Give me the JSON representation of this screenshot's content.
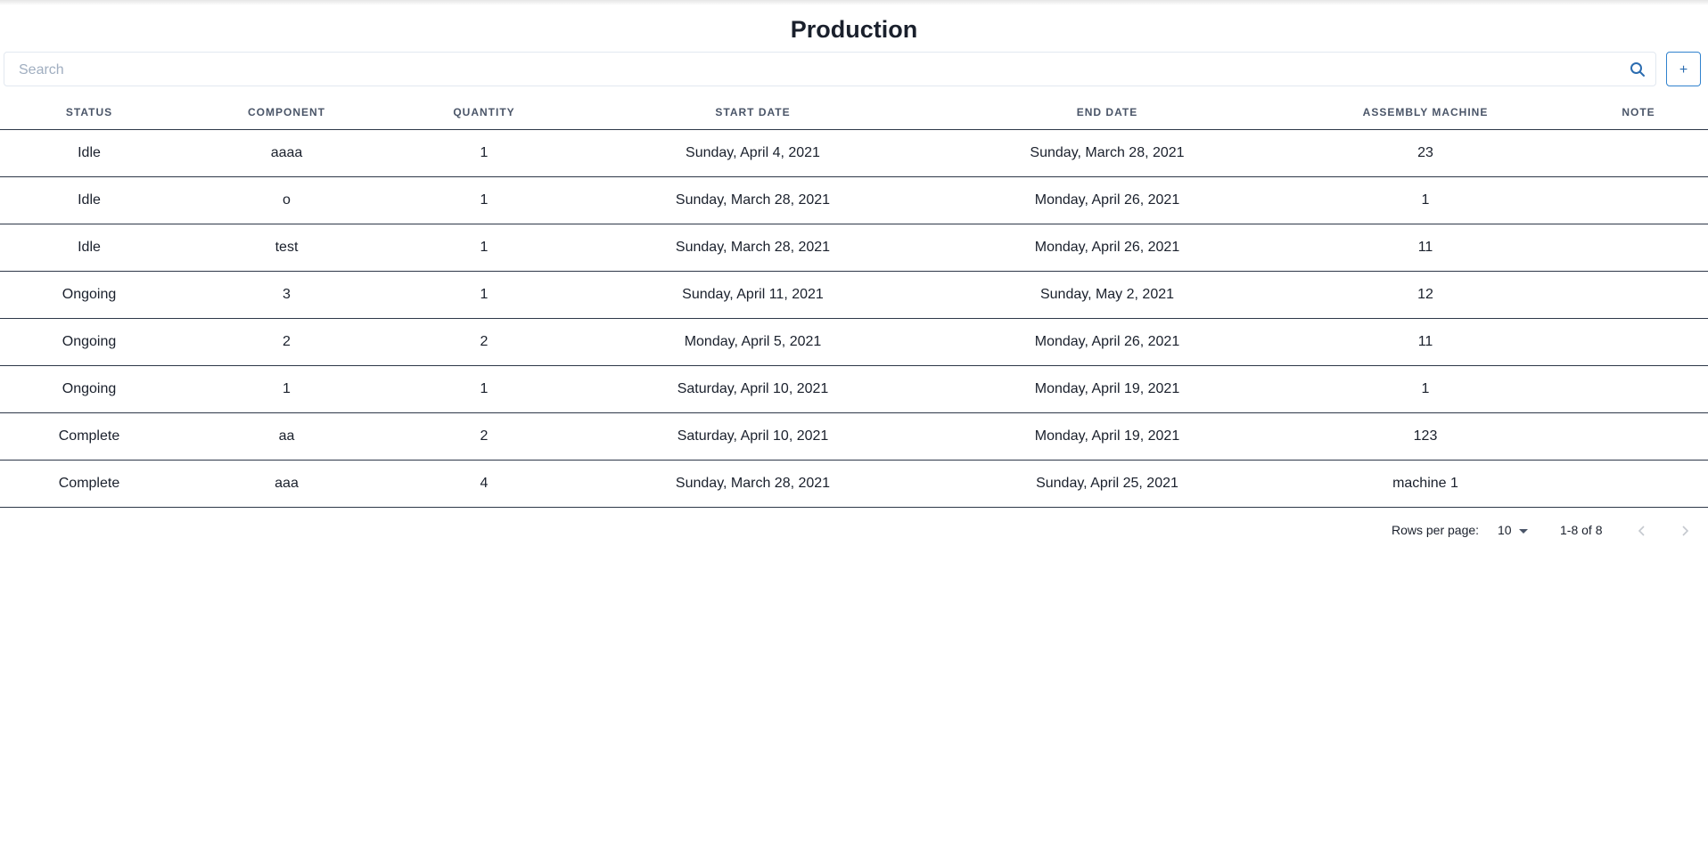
{
  "page": {
    "title": "Production"
  },
  "search": {
    "placeholder": "Search",
    "value": ""
  },
  "toolbar": {
    "add_label": "+"
  },
  "table": {
    "columns": [
      "Status",
      "Component",
      "Quantity",
      "Start Date",
      "End Date",
      "Assembly Machine",
      "Note"
    ],
    "rows": [
      [
        "Idle",
        "aaaa",
        "1",
        "Sunday, April 4, 2021",
        "Sunday, March 28, 2021",
        "23",
        ""
      ],
      [
        "Idle",
        "o",
        "1",
        "Sunday, March 28, 2021",
        "Monday, April 26, 2021",
        "1",
        ""
      ],
      [
        "Idle",
        "test",
        "1",
        "Sunday, March 28, 2021",
        "Monday, April 26, 2021",
        "11",
        ""
      ],
      [
        "Ongoing",
        "3",
        "1",
        "Sunday, April 11, 2021",
        "Sunday, May 2, 2021",
        "12",
        ""
      ],
      [
        "Ongoing",
        "2",
        "2",
        "Monday, April 5, 2021",
        "Monday, April 26, 2021",
        "11",
        ""
      ],
      [
        "Ongoing",
        "1",
        "1",
        "Saturday, April 10, 2021",
        "Monday, April 19, 2021",
        "1",
        ""
      ],
      [
        "Complete",
        "aa",
        "2",
        "Saturday, April 10, 2021",
        "Monday, April 19, 2021",
        "123",
        ""
      ],
      [
        "Complete",
        "aaa",
        "4",
        "Sunday, March 28, 2021",
        "Sunday, April 25, 2021",
        "machine 1",
        ""
      ]
    ]
  },
  "pagination": {
    "rows_per_page_label": "Rows per page:",
    "rows_per_page_value": "10",
    "range_text": "1-8 of 8"
  },
  "icons": {
    "search": "search-icon",
    "prev": "chevron-left-icon",
    "next": "chevron-right-icon",
    "dropdown": "caret-down-icon"
  },
  "colors": {
    "accent": "#3182ce",
    "header_text": "#4a5568",
    "border": "#2d3748"
  }
}
